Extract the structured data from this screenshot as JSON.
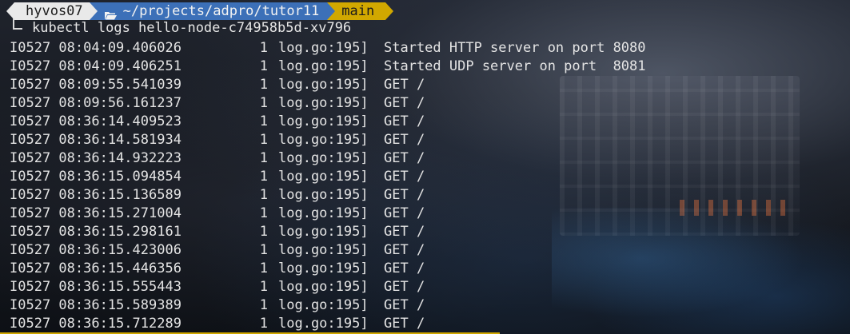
{
  "prompt": {
    "user": "hyvos07",
    "path": "~/projects/adpro/tutor11",
    "branch": "main",
    "icon": "folder-open-icon",
    "colors": {
      "user_bg": "#e9e9e9",
      "path_bg": "#3c70b8",
      "branch_bg": "#d1a800"
    }
  },
  "command": "kubectl logs hello-node-c74958b5d-xv796",
  "logs": [
    {
      "ts": "I0527 08:04:09.406026",
      "thread": "1",
      "src": "log.go:195]",
      "msg": "Started HTTP server on port 8080"
    },
    {
      "ts": "I0527 08:04:09.406251",
      "thread": "1",
      "src": "log.go:195]",
      "msg": "Started UDP server on port  8081"
    },
    {
      "ts": "I0527 08:09:55.541039",
      "thread": "1",
      "src": "log.go:195]",
      "msg": "GET /"
    },
    {
      "ts": "I0527 08:09:56.161237",
      "thread": "1",
      "src": "log.go:195]",
      "msg": "GET /"
    },
    {
      "ts": "I0527 08:36:14.409523",
      "thread": "1",
      "src": "log.go:195]",
      "msg": "GET /"
    },
    {
      "ts": "I0527 08:36:14.581934",
      "thread": "1",
      "src": "log.go:195]",
      "msg": "GET /"
    },
    {
      "ts": "I0527 08:36:14.932223",
      "thread": "1",
      "src": "log.go:195]",
      "msg": "GET /"
    },
    {
      "ts": "I0527 08:36:15.094854",
      "thread": "1",
      "src": "log.go:195]",
      "msg": "GET /"
    },
    {
      "ts": "I0527 08:36:15.136589",
      "thread": "1",
      "src": "log.go:195]",
      "msg": "GET /"
    },
    {
      "ts": "I0527 08:36:15.271004",
      "thread": "1",
      "src": "log.go:195]",
      "msg": "GET /"
    },
    {
      "ts": "I0527 08:36:15.298161",
      "thread": "1",
      "src": "log.go:195]",
      "msg": "GET /"
    },
    {
      "ts": "I0527 08:36:15.423006",
      "thread": "1",
      "src": "log.go:195]",
      "msg": "GET /"
    },
    {
      "ts": "I0527 08:36:15.446356",
      "thread": "1",
      "src": "log.go:195]",
      "msg": "GET /"
    },
    {
      "ts": "I0527 08:36:15.555443",
      "thread": "1",
      "src": "log.go:195]",
      "msg": "GET /"
    },
    {
      "ts": "I0527 08:36:15.589389",
      "thread": "1",
      "src": "log.go:195]",
      "msg": "GET /"
    },
    {
      "ts": "I0527 08:36:15.712289",
      "thread": "1",
      "src": "log.go:195]",
      "msg": "GET /"
    }
  ]
}
